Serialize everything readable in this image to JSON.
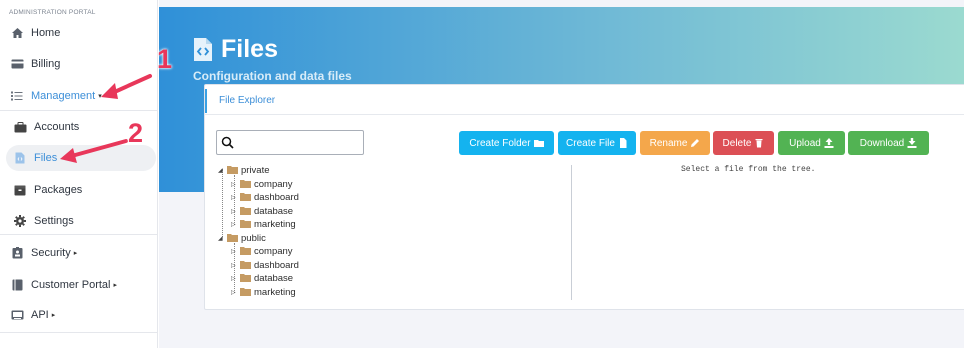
{
  "sidebar": {
    "portal_title": "ADMINISTRATION PORTAL",
    "items": [
      {
        "label": "Home",
        "icon": "home-icon"
      },
      {
        "label": "Billing",
        "icon": "credit-card-icon"
      },
      {
        "label": "Management",
        "icon": "list-icon",
        "caret": "▾"
      },
      {
        "label": "Accounts",
        "icon": "briefcase-icon"
      },
      {
        "label": "Files",
        "icon": "file-code-icon"
      },
      {
        "label": "Packages",
        "icon": "package-icon"
      },
      {
        "label": "Settings",
        "icon": "gear-icon"
      },
      {
        "label": "Security",
        "icon": "id-badge-icon",
        "caret": "▸"
      },
      {
        "label": "Customer Portal",
        "icon": "book-icon",
        "caret": "▸"
      },
      {
        "label": "API",
        "icon": "terminal-icon",
        "caret": "▸"
      }
    ]
  },
  "header": {
    "title": "Files",
    "subtitle": "Configuration and data files"
  },
  "card": {
    "title": "File Explorer"
  },
  "search": {
    "placeholder": "",
    "value": ""
  },
  "toolbar": {
    "create_folder": "Create Folder",
    "create_file": "Create File",
    "rename": "Rename",
    "delete": "Delete",
    "upload": "Upload",
    "download": "Download"
  },
  "tree": {
    "private": {
      "label": "private",
      "children": [
        "company",
        "dashboard",
        "database",
        "marketing"
      ]
    },
    "public": {
      "label": "public",
      "children": [
        "company",
        "dashboard",
        "database",
        "marketing"
      ]
    }
  },
  "preview": {
    "hint": "Select a file from the tree."
  },
  "annotations": {
    "step1": "1",
    "step2": "2"
  },
  "colors": {
    "accent": "#3d8fd8",
    "annotation": "#e8375a",
    "btn_blue": "#14b3ef",
    "btn_orange": "#f4a74b",
    "btn_red": "#dc4f55",
    "btn_green": "#52b353"
  }
}
